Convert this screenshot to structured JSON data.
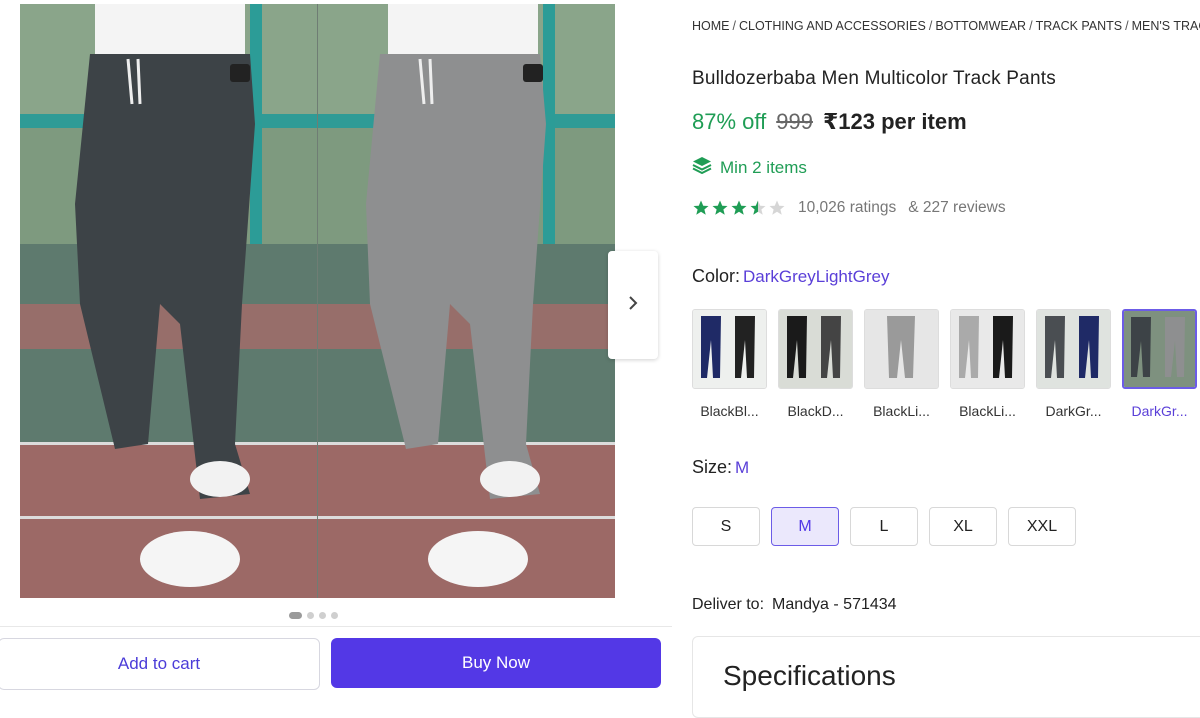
{
  "gallery": {
    "next_arrow": "chevron-right-icon",
    "dots": 4,
    "active_dot": 0
  },
  "actions": {
    "add_to_cart": "Add to cart",
    "buy_now": "Buy Now"
  },
  "breadcrumb": [
    "HOME",
    "CLOTHING AND ACCESSORIES",
    "BOTTOMWEAR",
    "TRACK PANTS",
    "MEN'S TRAC"
  ],
  "product": {
    "title": "Bulldozerbaba Men Multicolor Track Pants",
    "discount": "87% off",
    "mrp": "999",
    "price": "₹123 per item",
    "min_items": "Min 2 items",
    "rating_stars": 3.5,
    "ratings": "10,026 ratings",
    "reviews": "& 227 reviews"
  },
  "color": {
    "label": "Color:",
    "selected": "DarkGreyLightGrey",
    "options": [
      "BlackBl...",
      "BlackD...",
      "BlackLi...",
      "BlackLi...",
      "DarkGr...",
      "DarkGr..."
    ],
    "selected_index": 5
  },
  "size": {
    "label": "Size:",
    "selected": "M",
    "options": [
      "S",
      "M",
      "L",
      "XL",
      "XXL"
    ],
    "selected_index": 1
  },
  "delivery": {
    "label": "Deliver to:",
    "location": "Mandya - 571434"
  },
  "specifications": {
    "title": "Specifications"
  },
  "colors": {
    "accent": "#5338e6",
    "green": "#1f9d55",
    "star": "#1f9d55"
  }
}
